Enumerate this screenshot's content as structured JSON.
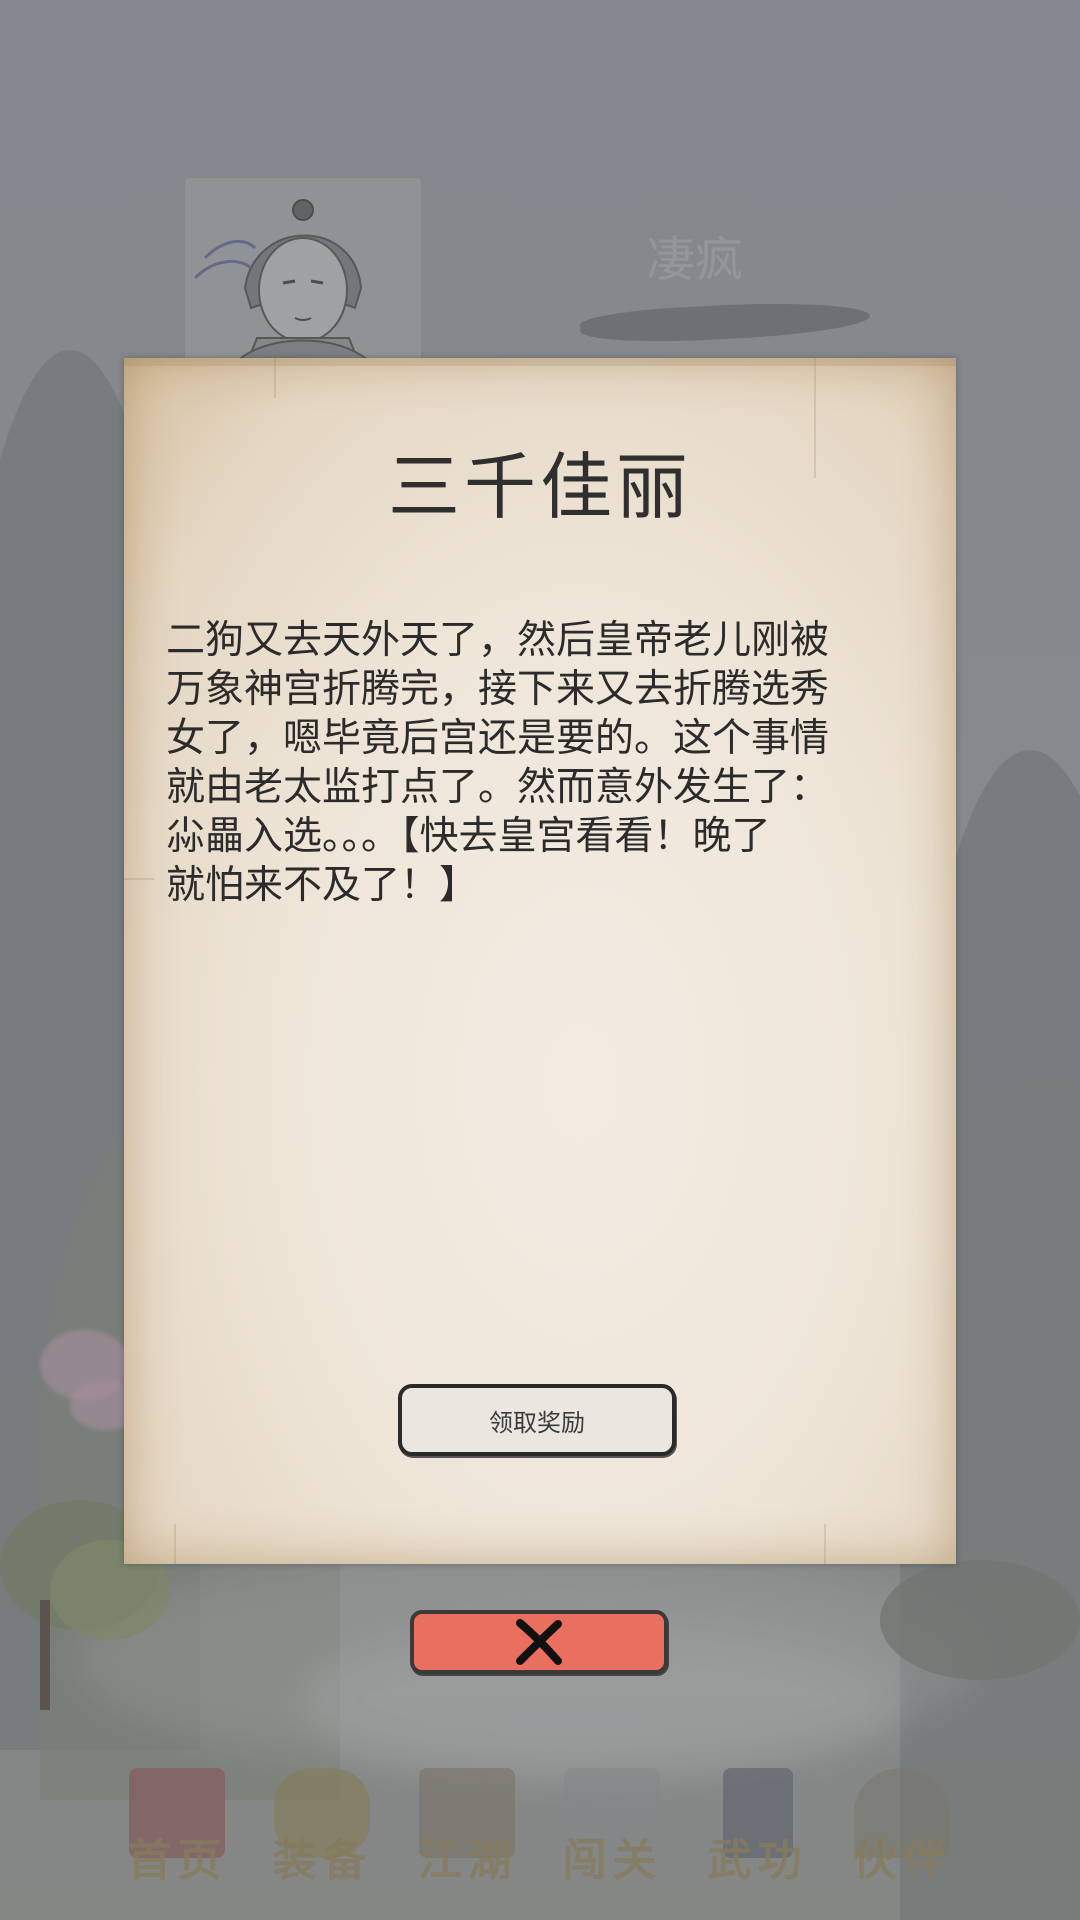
{
  "profile": {
    "hero_name": "凄疯"
  },
  "dialog": {
    "title": "三千佳丽",
    "body": "二狗又去天外天了，然后皇帝老儿刚被\n万象神宫折腾完，接下来又去折腾选秀\n女了，嗯毕竟后宫还是要的。这个事情\n就由老太监打点了。然而意外发生了：\n尛畾入选。。。【快去皇宫看看！晚了\n就怕来不及了！】",
    "claim_button_label": "领取奖励",
    "close_icon": "close-icon"
  },
  "bottom_nav": {
    "items": [
      {
        "label": "首页",
        "icon": "palace-icon"
      },
      {
        "label": "装备",
        "icon": "armor-icon"
      },
      {
        "label": "江湖",
        "icon": "scroll-icon"
      },
      {
        "label": "闯关",
        "icon": "swords-icon"
      },
      {
        "label": "武功",
        "icon": "book-icon"
      },
      {
        "label": "伙伴",
        "icon": "people-icon"
      }
    ]
  },
  "colors": {
    "close_button": "#e9705e",
    "parchment": "#efe6d9",
    "nav_label": "#8d7a4a"
  }
}
